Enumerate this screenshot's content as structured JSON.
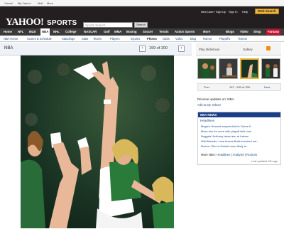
{
  "top_links": {
    "yahoo": "Yahoo!",
    "my_yahoo": "My Yahoo!",
    "mail": "Mail",
    "more": "More"
  },
  "header_links": {
    "new_user": "New User? Sign Up",
    "sign_in": "Sign In",
    "help": "Help"
  },
  "brand": {
    "yahoo": "YAHOO!",
    "sports": "SPORTS"
  },
  "search": {
    "placeholder": "Sports Search",
    "button": "Search",
    "web_search": "Web Search"
  },
  "nav": [
    "Home",
    "NFL",
    "MLB",
    "NBA",
    "NHL",
    "College",
    "NASCAR",
    "Golf",
    "MMA",
    "Boxing",
    "Soccer",
    "Tennis",
    "Action Sports",
    "More",
    "Blogs",
    "Video",
    "Shop",
    "Fantasy"
  ],
  "subnav": [
    "NBA Home",
    "Scores & Schedule",
    "Standings",
    "Stats",
    "Teams",
    "Players",
    "Injuries",
    "Photos",
    "Odds",
    "Video",
    "Blog",
    "Rumor",
    "PlayoffS",
    "Tickets"
  ],
  "gallery": {
    "title": "NBA",
    "counter": "199 of 200",
    "prev": "‹",
    "next": "›"
  },
  "side": {
    "play_slideshow": "Play Slideshow",
    "gallery": "Gallery"
  },
  "controls": {
    "prev": "Prev",
    "range": "197 - 200 of 200",
    "next": "Next"
  },
  "receive_text": "Receive updates on: NBA",
  "add_yahoo": "Add to My Yahoo!",
  "news": {
    "title": "NBA NEWS",
    "tab": "Headlines",
    "items": [
      "Magic's Howard suspended for Game 6",
      "Mavs aim for more with playoff skid over",
      "Nuggets' Anthony takes aim at Lakers",
      "Wiz/Wizards: Lose leaves Bulls knocked out...",
      "Rumor: Who is Detroit more likely to..."
    ],
    "more_label": "More NBA:",
    "more_links": [
      "Headlines",
      "Analysis",
      "Rumors"
    ],
    "updated": "Last updated 19h ago"
  },
  "colors": {
    "header": "#231f20",
    "navbar": "#3b3b3b",
    "accent": "#f0b43c",
    "link": "#1a4a8a",
    "fantasy": "#c8102e"
  }
}
